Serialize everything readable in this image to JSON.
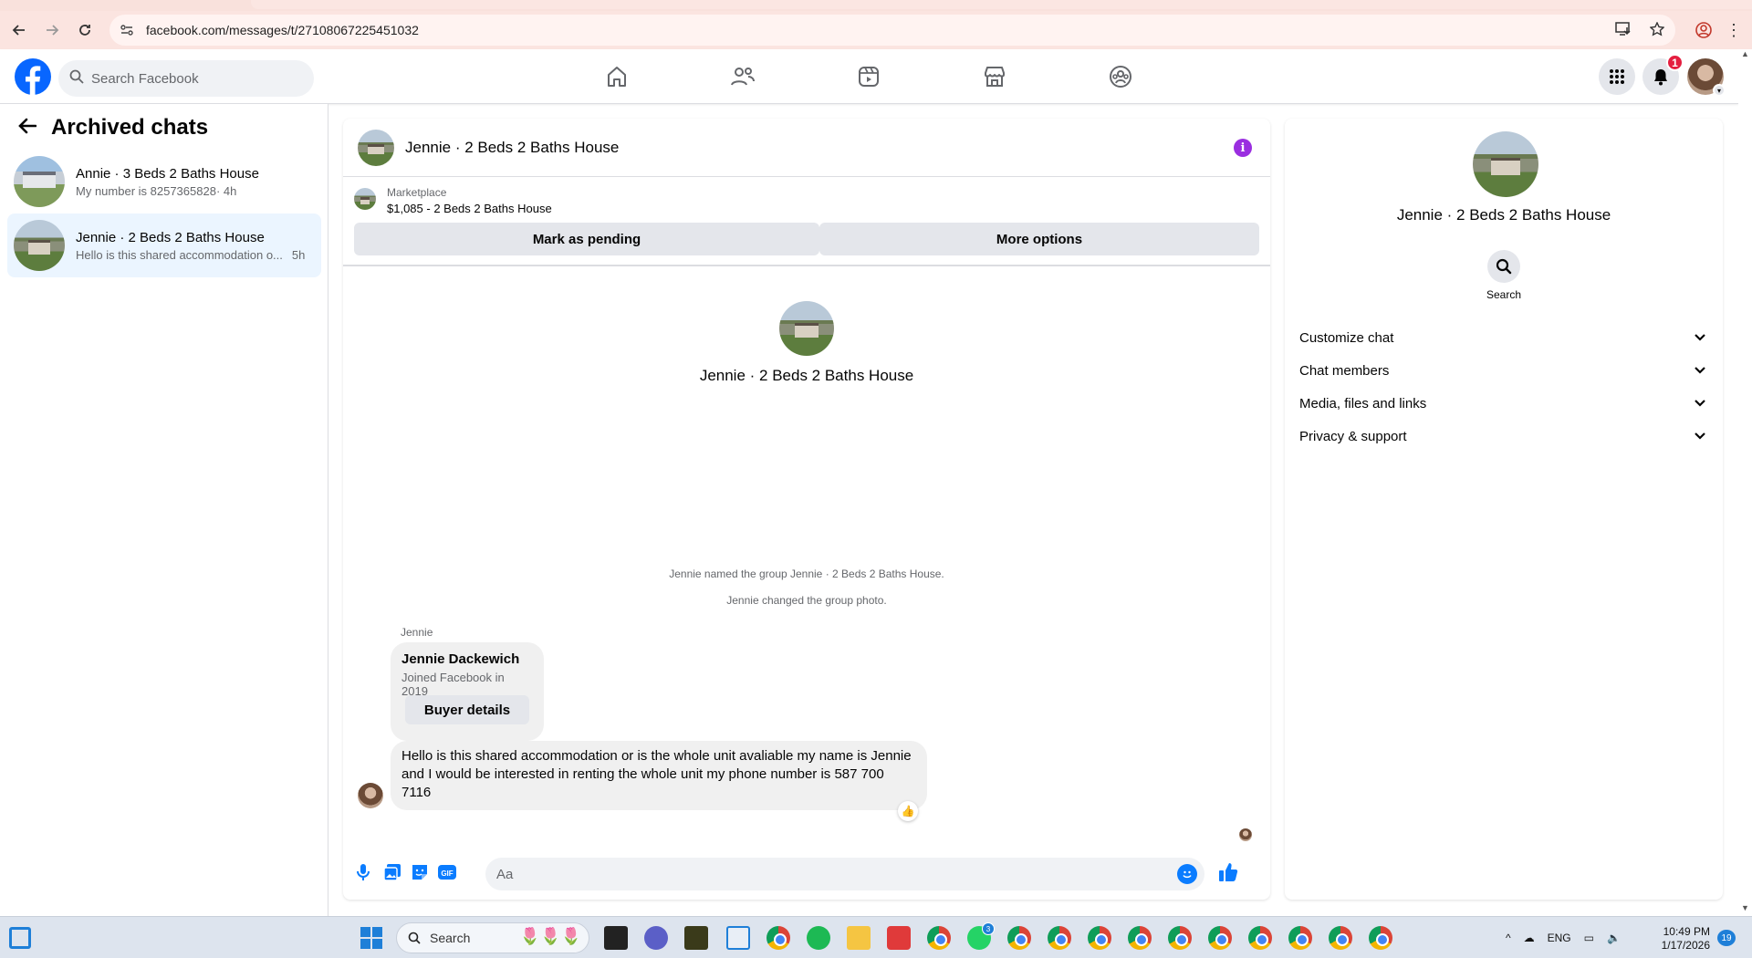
{
  "browser": {
    "url": "facebook.com/messages/t/27108067225451032"
  },
  "header": {
    "search_placeholder": "Search Facebook",
    "notification_count": "1"
  },
  "sidebar": {
    "title": "Archived chats",
    "chats": [
      {
        "name": "Annie · 3 Beds 2 Baths House",
        "snippet": "My number is 8257365828",
        "time": "· 4h",
        "active": false
      },
      {
        "name": "Jennie · 2 Beds 2 Baths House",
        "snippet": "Hello is this shared accommodation o...",
        "time": "5h",
        "active": true
      }
    ]
  },
  "conversation": {
    "title": "Jennie · 2 Beds 2 Baths House",
    "marketplace_label": "Marketplace",
    "marketplace_item": "$1,085 - 2 Beds 2 Baths House",
    "mark_pending_label": "Mark as pending",
    "more_options_label": "More options",
    "intro_name": "Jennie · 2 Beds 2 Baths House",
    "system_messages": [
      "Jennie named the group Jennie · 2 Beds 2 Baths House.",
      "Jennie changed the group photo."
    ],
    "sender_label": "Jennie",
    "buyer_card": {
      "name": "Jennie Dackewich",
      "joined": "Joined Facebook in 2019",
      "button_label": "Buyer details"
    },
    "message": "Hello is this shared accommodation or is the whole unit avaliable my name is Jennie and I would be interested in renting the whole unit my phone number is 587 700 7116",
    "reaction": "👍",
    "composer_placeholder": "Aa"
  },
  "details_panel": {
    "name": "Jennie · 2 Beds 2 Baths House",
    "search_label": "Search",
    "sections": [
      "Customize chat",
      "Chat members",
      "Media, files and links",
      "Privacy & support"
    ]
  },
  "taskbar": {
    "search_label": "Search",
    "language": "ENG",
    "time": "10:49 PM",
    "date": "1/17/2026",
    "notification_count": "19",
    "whatsapp_badge": "3"
  },
  "colors": {
    "facebook_blue": "#0866ff",
    "messenger_blue": "#0a7cff",
    "info_purple": "#9a2ee0",
    "badge_red": "#e41e3f",
    "active_chat_bg": "#ebf5ff"
  },
  "icons": [
    "back-arrow-icon",
    "forward-arrow-icon",
    "reload-icon",
    "site-info-icon",
    "install-icon",
    "star-icon",
    "profile-icon",
    "menu-icon",
    "search-icon",
    "home-icon",
    "friends-icon",
    "video-icon",
    "marketplace-icon",
    "groups-icon",
    "grid-menu-icon",
    "bell-icon",
    "info-icon",
    "chevron-down-icon",
    "mic-icon",
    "photo-icon",
    "sticker-icon",
    "gif-icon",
    "emoji-icon",
    "thumbs-up-icon"
  ]
}
